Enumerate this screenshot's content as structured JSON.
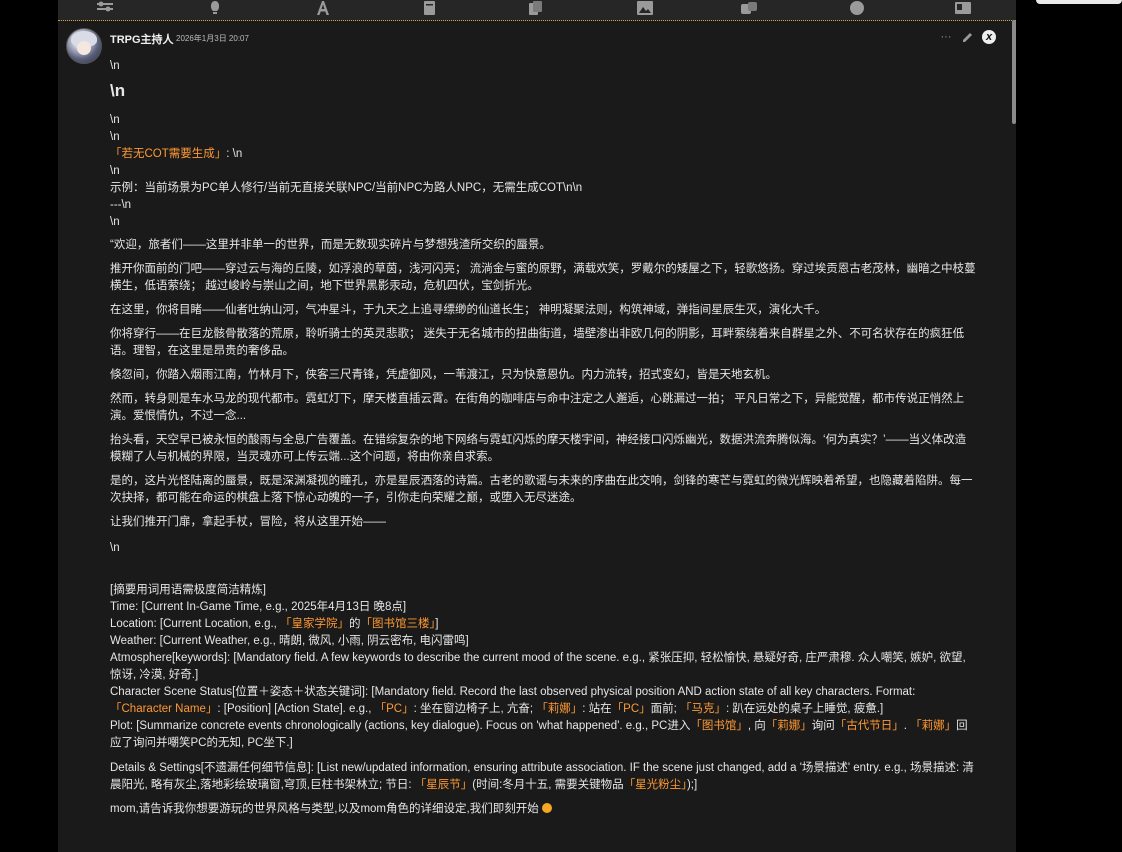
{
  "message": {
    "author": "TRPG主持人",
    "timestamp": "2026年1月3日 20:07",
    "menu_label": "···",
    "close_label": "x"
  },
  "lines": {
    "l1": "\\n",
    "heading": "\\n",
    "l3": "\\n",
    "l4": "\\n",
    "l5_hl": "「若无COT需要生成」",
    "l5_rest": ": \\n",
    "l6": "\\n",
    "l7": "示例：当前场景为PC单人修行/当前无直接关联NPC/当前NPC为路人NPC，无需生成COT\\n\\n",
    "l8": "---\\n",
    "l9": "\\n"
  },
  "paragraphs": [
    "“欢迎，旅者们——这里并非单一的世界，而是无数现实碎片与梦想残渣所交织的蜃景。",
    "推开你面前的门吧——穿过云与海的丘陵，如浮浪的草茵，浅河闪亮； 流淌金与蜜的原野，满载欢笑，罗戴尔的矮屋之下，轻歌悠扬。穿过埃贡恩古老茂林，幽暗之中枝蔓横生，低语萦绕； 越过峻岭与崇山之间，地下世界黑影汞动，危机四伏，宝剑折光。",
    "在这里，你将目睹——仙者吐纳山河，气冲星斗，于九天之上追寻缥缈的仙道长生； 神明凝聚法则，构筑神域，弹指间星辰生灭，演化大千。",
    "你将穿行——在巨龙骸骨散落的荒原，聆听骑士的英灵悲歌； 迷失于无名城市的扭曲街道，墙壁渗出非欧几何的阴影，耳畔萦绕着来自群星之外、不可名状存在的疯狂低语。理智，在这里是昂贵的奢侈品。",
    "倏忽间，你踏入烟雨江南，竹林月下，侠客三尺青锋，凭虚御风，一苇渡江，只为快意恩仇。内力流转，招式变幻，皆是天地玄机。",
    "然而，转身则是车水马龙的现代都市。霓虹灯下，摩天楼直插云霄。在街角的咖啡店与命中注定之人邂逅，心跳漏过一拍； 平凡日常之下，异能觉醒，都市传说正悄然上演。爱恨情仇，不过一念...",
    "抬头看，天空早已被永恒的酸雨与全息广告覆盖。在错综复杂的地下网络与霓虹闪烁的摩天楼宇间，神经接口闪烁幽光，数据洪流奔腾似海。‘何为真实？’——当义体改造模糊了人与机械的界限，当灵魂亦可上传云端...这个问题，将由你亲自求索。",
    "是的，这片光怪陆离的蜃景，既是深渊凝视的瞳孔，亦是星辰洒落的诗篇。古老的歌谣与未来的序曲在此交响，剑锋的寒芒与霓虹的微光辉映着希望，也隐藏着陷阱。每一次抉择，都可能在命运的棋盘上落下惊心动魄的一子，引你走向荣耀之巅，或堕入无尽迷途。",
    "让我们推开门扉，拿起手杖，冒险，将从这里开始——"
  ],
  "after": {
    "l_n": "\\n"
  },
  "summary": {
    "header": "[摘要用词用语需极度简洁精炼]",
    "time": "Time: [Current In-Game Time, e.g., 2025年4月13日 晚8点]",
    "loc_a": "Location: [Current Location, e.g., ",
    "loc_h1": "「皇家学院」",
    "loc_b": "的",
    "loc_h2": "「图书馆三楼」",
    "loc_c": "]",
    "weather": "Weather: [Current Weather, e.g., 晴朗, 微风, 小雨, 阴云密布, 电闪雷鸣]",
    "atmos": "Atmosphere[keywords]: [Mandatory field. A few keywords to describe the current mood of the scene. e.g., 紧张压抑, 轻松愉快, 悬疑好奇, 庄严肃穆. 众人嘲笑, 嫉妒, 欲望, 惊讶, 冷漠, 好奇.]",
    "css_a": "Character Scene Status[位置＋姿态＋状态关键词]: [Mandatory field. Record the last observed physical position AND action state of all key characters. Format: ",
    "css_h1": "「Character Name」",
    "css_b": ": [Position] [Action State]. e.g., ",
    "css_h2": "「PC」",
    "css_c": ": 坐在窗边椅子上, 亢奋; ",
    "css_h3": "「莉娜」",
    "css_d": ": 站在",
    "css_h4": "「PC」",
    "css_e": "面前; ",
    "css_h5": "「马克」",
    "css_f": ": 趴在远处的桌子上睡觉, 疲惫.]",
    "plot_a": "Plot: [Summarize concrete events chronologically (actions, key dialogue). Focus on 'what happened'. e.g., PC进入",
    "plot_h1": "「图书馆」",
    "plot_b": ", 向",
    "plot_h2": "「莉娜」",
    "plot_c": "询问",
    "plot_h3": "「古代节日」",
    "plot_d": ". ",
    "plot_h4": "「莉娜」",
    "plot_e": "回应了询问并嘲笑PC的无知, PC坐下.]",
    "det_a": "Details & Settings[不遗漏任何细节信息]: [List new/updated information, ensuring attribute association. IF the scene just changed, add a '场景描述' entry. e.g., 场景描述: 清晨阳光, 略有灰尘,落地彩绘玻璃窗,穹顶,巨柱书架林立; 节日: ",
    "det_h1": "「星辰节」",
    "det_b": "(时间:冬月十五, 需要关键物品",
    "det_h2": "「星光粉尘」",
    "det_c": ");]",
    "final": "mom,请告诉我你想要游玩的世界风格与类型,以及mom角色的详细设定,我们即刻开始"
  },
  "icons": [
    "sliders-icon",
    "lightbulb-icon",
    "font-icon",
    "book-icon",
    "image-icon",
    "dice-icon",
    "smile-icon",
    "id-card-icon"
  ]
}
